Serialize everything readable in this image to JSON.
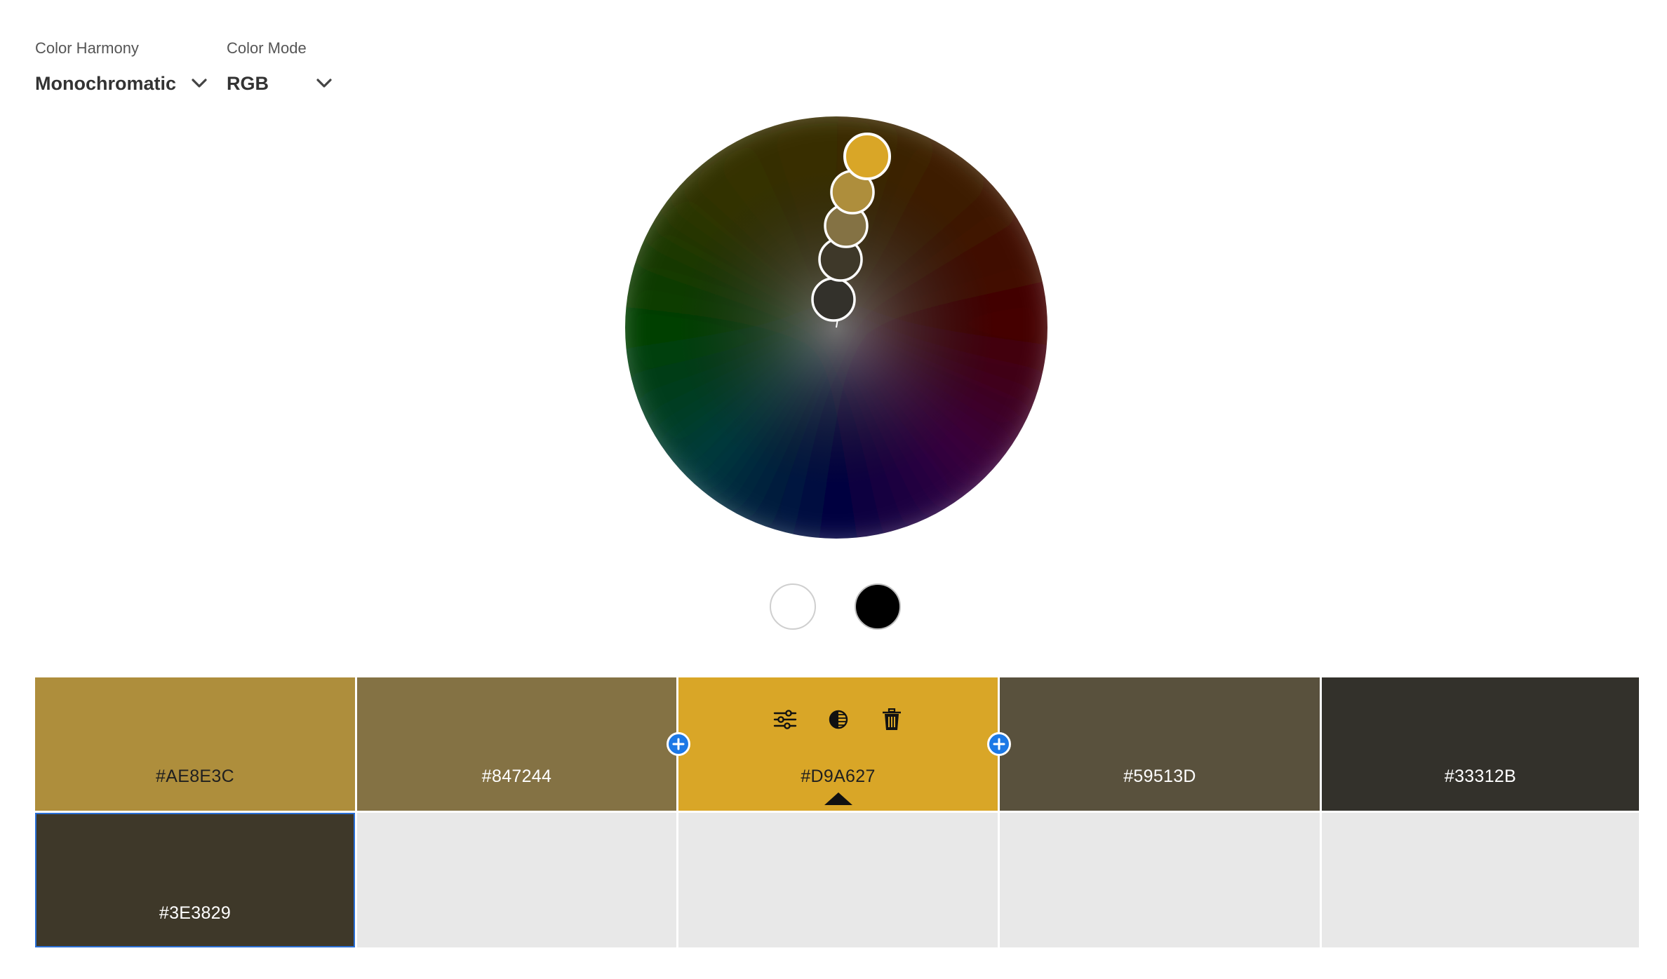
{
  "controls": {
    "harmony": {
      "label": "Color Harmony",
      "value": "Monochromatic",
      "icon": "chevron-down-icon"
    },
    "mode": {
      "label": "Color Mode",
      "value": "RGB",
      "icon": "chevron-down-icon"
    }
  },
  "wheel": {
    "markers": [
      {
        "color": "#D9A627",
        "active": true
      },
      {
        "color": "#AE8E3C"
      },
      {
        "color": "#847244"
      },
      {
        "color": "#3E3829"
      },
      {
        "color": "#33312B"
      }
    ]
  },
  "swatch_extras": {
    "white": "#FFFFFF",
    "black": "#000000"
  },
  "swatches": [
    {
      "hex": "#AE8E3C",
      "color": "#AE8E3C",
      "text_tone": "dark"
    },
    {
      "hex": "#847244",
      "color": "#847244",
      "text_tone": "light"
    },
    {
      "hex": "#D9A627",
      "color": "#D9A627",
      "text_tone": "dark",
      "base": true,
      "tools": [
        "sliders-icon",
        "contrast-icon",
        "trash-icon"
      ]
    },
    {
      "hex": "#59513D",
      "color": "#59513D",
      "text_tone": "light"
    },
    {
      "hex": "#33312B",
      "color": "#33312B",
      "text_tone": "light"
    },
    {
      "hex": "#3E3829",
      "color": "#3E3829",
      "text_tone": "light",
      "selected": true
    }
  ],
  "add_button_icon": "plus-icon",
  "colors": {
    "accent": "#1B78E6",
    "empty_cell": "#E8E8E8"
  }
}
